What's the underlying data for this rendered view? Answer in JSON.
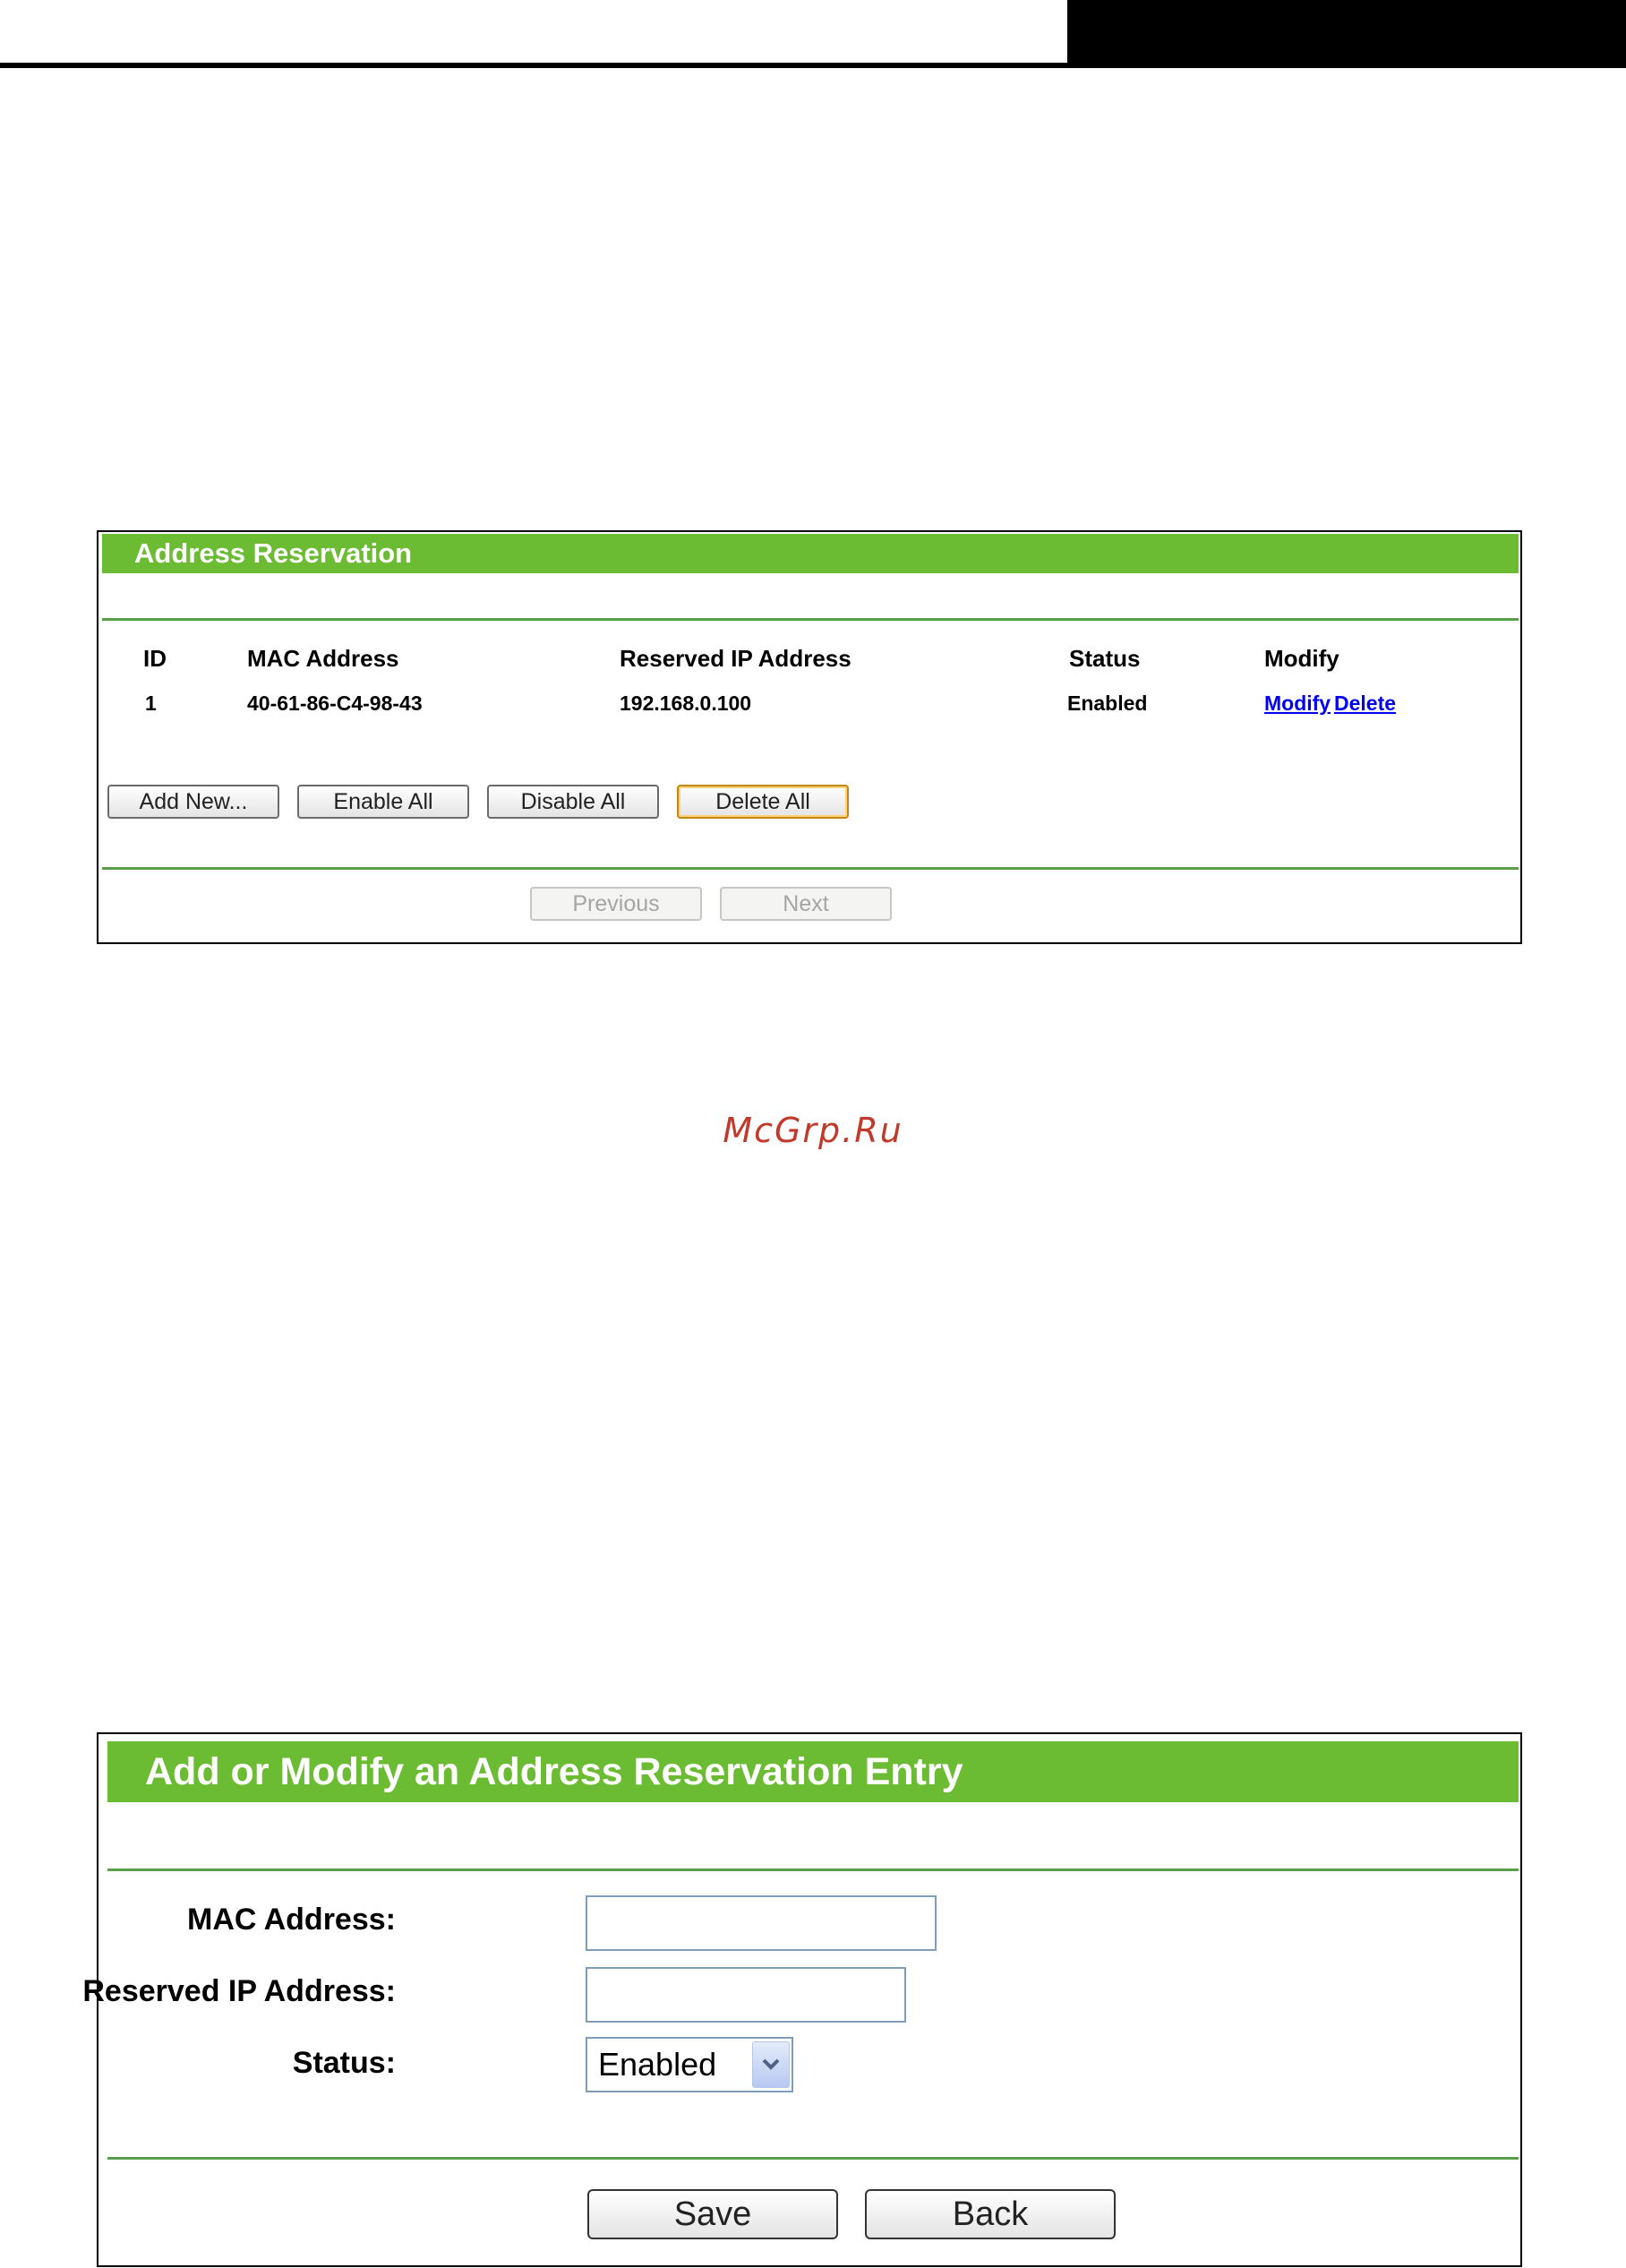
{
  "watermark": "McGrp.Ru",
  "reservation_panel": {
    "title": "Address Reservation",
    "columns": {
      "id": "ID",
      "mac": "MAC Address",
      "ip": "Reserved IP Address",
      "status": "Status",
      "modify": "Modify"
    },
    "rows": [
      {
        "id": "1",
        "mac": "40-61-86-C4-98-43",
        "ip": "192.168.0.100",
        "status": "Enabled",
        "modify_link": "Modify",
        "delete_link": "Delete"
      }
    ],
    "buttons": {
      "add_new": "Add New...",
      "enable_all": "Enable All",
      "disable_all": "Disable All",
      "delete_all": "Delete All"
    },
    "pagination": {
      "previous": "Previous",
      "next": "Next"
    }
  },
  "entry_panel": {
    "title": "Add or Modify an Address Reservation Entry",
    "mac_label": "MAC Address:",
    "mac_value": "",
    "ip_label": "Reserved IP Address:",
    "ip_value": "",
    "status_label": "Status:",
    "status_selected": "Enabled",
    "save": "Save",
    "back": "Back"
  },
  "colors": {
    "header_green": "#6bbb33",
    "divider_green": "#5a9e4c",
    "link_blue": "#0000ee"
  }
}
